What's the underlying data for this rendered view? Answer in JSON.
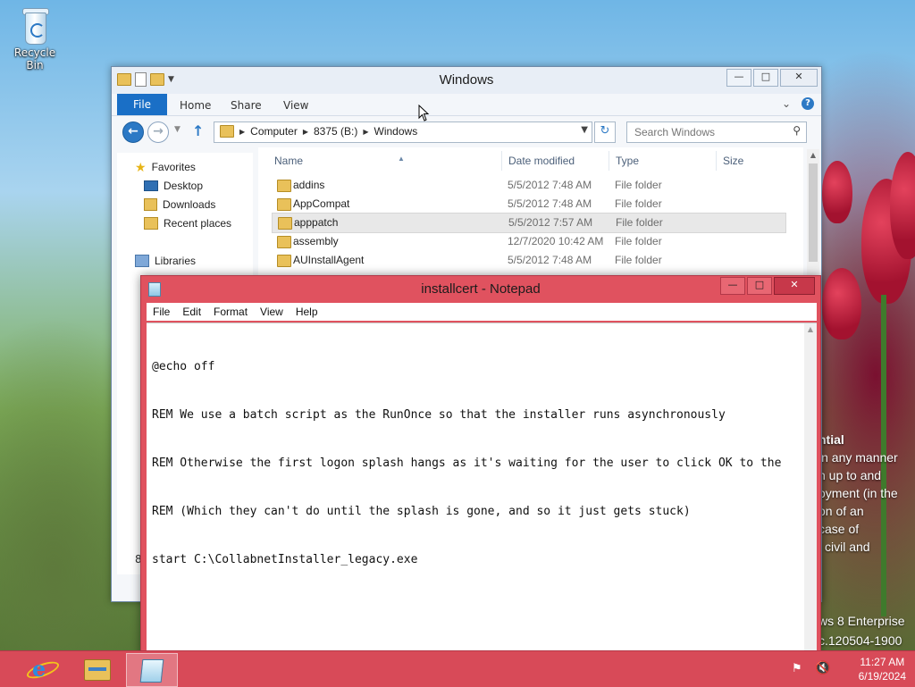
{
  "desktop": {
    "recycle_bin_label": "Recycle Bin",
    "watermark_lines": [
      "ntial",
      "in any manner",
      "n up to and",
      "oyment (in the",
      "on of an",
      "case of",
      "l civil and"
    ],
    "version_lines": [
      "ws 8 Enterprise",
      "c.120504-1900"
    ]
  },
  "explorer": {
    "title": "Windows",
    "ribbon_tabs": [
      "File",
      "Home",
      "Share",
      "View"
    ],
    "breadcrumbs": [
      "Computer",
      "8375 (B:)",
      "Windows"
    ],
    "search_placeholder": "Search Windows",
    "nav": {
      "favorites_label": "Favorites",
      "favorites_items": [
        "Desktop",
        "Downloads",
        "Recent places"
      ],
      "libraries_label": "Libraries"
    },
    "columns": [
      "Name",
      "Date modified",
      "Type",
      "Size"
    ],
    "files": [
      {
        "name": "addins",
        "date": "5/5/2012 7:48 AM",
        "type": "File folder"
      },
      {
        "name": "AppCompat",
        "date": "5/5/2012 7:48 AM",
        "type": "File folder"
      },
      {
        "name": "apppatch",
        "date": "5/5/2012 7:57 AM",
        "type": "File folder"
      },
      {
        "name": "assembly",
        "date": "12/7/2020 10:42 AM",
        "type": "File folder"
      },
      {
        "name": "AUInstallAgent",
        "date": "5/5/2012 7:48 AM",
        "type": "File folder"
      }
    ],
    "selected_row": "apppatch",
    "status_count": "88"
  },
  "notepad": {
    "title": "installcert - Notepad",
    "menu": [
      "File",
      "Edit",
      "Format",
      "View",
      "Help"
    ],
    "lines": [
      "@echo off",
      "REM We use a batch script as the RunOnce so that the installer runs asynchronously",
      "REM Otherwise the first logon splash hangs as it's waiting for the user to click OK to the",
      "REM (Which they can't do until the splash is gone, and so it just gets stuck)",
      "start C:\\CollabnetInstaller_legacy.exe"
    ]
  },
  "taskbar": {
    "apps": [
      "internet-explorer",
      "file-explorer",
      "notepad"
    ],
    "active_app": "notepad",
    "clock_time": "11:27 AM",
    "clock_date": "6/19/2024"
  },
  "colors": {
    "accent": "#d84a58",
    "ribbon_file": "#1a6fc6"
  }
}
